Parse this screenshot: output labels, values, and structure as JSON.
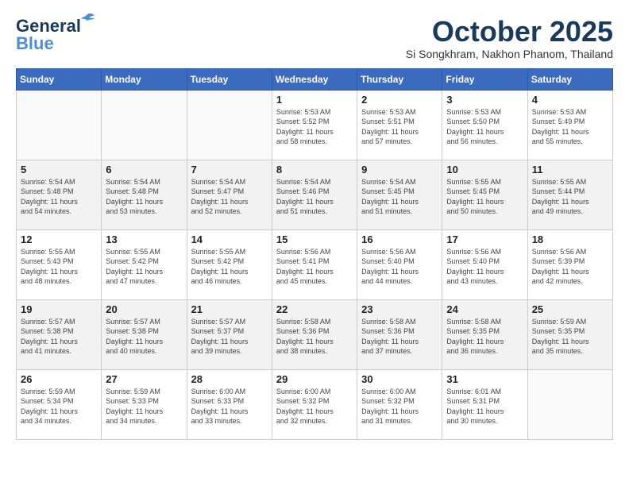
{
  "app": {
    "logo_line1": "General",
    "logo_line2": "Blue"
  },
  "title": "October 2025",
  "subtitle": "Si Songkhram, Nakhon Phanom, Thailand",
  "weekdays": [
    "Sunday",
    "Monday",
    "Tuesday",
    "Wednesday",
    "Thursday",
    "Friday",
    "Saturday"
  ],
  "weeks": [
    [
      {
        "day": "",
        "info": ""
      },
      {
        "day": "",
        "info": ""
      },
      {
        "day": "",
        "info": ""
      },
      {
        "day": "1",
        "info": "Sunrise: 5:53 AM\nSunset: 5:52 PM\nDaylight: 11 hours\nand 58 minutes."
      },
      {
        "day": "2",
        "info": "Sunrise: 5:53 AM\nSunset: 5:51 PM\nDaylight: 11 hours\nand 57 minutes."
      },
      {
        "day": "3",
        "info": "Sunrise: 5:53 AM\nSunset: 5:50 PM\nDaylight: 11 hours\nand 56 minutes."
      },
      {
        "day": "4",
        "info": "Sunrise: 5:53 AM\nSunset: 5:49 PM\nDaylight: 11 hours\nand 55 minutes."
      }
    ],
    [
      {
        "day": "5",
        "info": "Sunrise: 5:54 AM\nSunset: 5:48 PM\nDaylight: 11 hours\nand 54 minutes."
      },
      {
        "day": "6",
        "info": "Sunrise: 5:54 AM\nSunset: 5:48 PM\nDaylight: 11 hours\nand 53 minutes."
      },
      {
        "day": "7",
        "info": "Sunrise: 5:54 AM\nSunset: 5:47 PM\nDaylight: 11 hours\nand 52 minutes."
      },
      {
        "day": "8",
        "info": "Sunrise: 5:54 AM\nSunset: 5:46 PM\nDaylight: 11 hours\nand 51 minutes."
      },
      {
        "day": "9",
        "info": "Sunrise: 5:54 AM\nSunset: 5:45 PM\nDaylight: 11 hours\nand 51 minutes."
      },
      {
        "day": "10",
        "info": "Sunrise: 5:55 AM\nSunset: 5:45 PM\nDaylight: 11 hours\nand 50 minutes."
      },
      {
        "day": "11",
        "info": "Sunrise: 5:55 AM\nSunset: 5:44 PM\nDaylight: 11 hours\nand 49 minutes."
      }
    ],
    [
      {
        "day": "12",
        "info": "Sunrise: 5:55 AM\nSunset: 5:43 PM\nDaylight: 11 hours\nand 48 minutes."
      },
      {
        "day": "13",
        "info": "Sunrise: 5:55 AM\nSunset: 5:42 PM\nDaylight: 11 hours\nand 47 minutes."
      },
      {
        "day": "14",
        "info": "Sunrise: 5:55 AM\nSunset: 5:42 PM\nDaylight: 11 hours\nand 46 minutes."
      },
      {
        "day": "15",
        "info": "Sunrise: 5:56 AM\nSunset: 5:41 PM\nDaylight: 11 hours\nand 45 minutes."
      },
      {
        "day": "16",
        "info": "Sunrise: 5:56 AM\nSunset: 5:40 PM\nDaylight: 11 hours\nand 44 minutes."
      },
      {
        "day": "17",
        "info": "Sunrise: 5:56 AM\nSunset: 5:40 PM\nDaylight: 11 hours\nand 43 minutes."
      },
      {
        "day": "18",
        "info": "Sunrise: 5:56 AM\nSunset: 5:39 PM\nDaylight: 11 hours\nand 42 minutes."
      }
    ],
    [
      {
        "day": "19",
        "info": "Sunrise: 5:57 AM\nSunset: 5:38 PM\nDaylight: 11 hours\nand 41 minutes."
      },
      {
        "day": "20",
        "info": "Sunrise: 5:57 AM\nSunset: 5:38 PM\nDaylight: 11 hours\nand 40 minutes."
      },
      {
        "day": "21",
        "info": "Sunrise: 5:57 AM\nSunset: 5:37 PM\nDaylight: 11 hours\nand 39 minutes."
      },
      {
        "day": "22",
        "info": "Sunrise: 5:58 AM\nSunset: 5:36 PM\nDaylight: 11 hours\nand 38 minutes."
      },
      {
        "day": "23",
        "info": "Sunrise: 5:58 AM\nSunset: 5:36 PM\nDaylight: 11 hours\nand 37 minutes."
      },
      {
        "day": "24",
        "info": "Sunrise: 5:58 AM\nSunset: 5:35 PM\nDaylight: 11 hours\nand 36 minutes."
      },
      {
        "day": "25",
        "info": "Sunrise: 5:59 AM\nSunset: 5:35 PM\nDaylight: 11 hours\nand 35 minutes."
      }
    ],
    [
      {
        "day": "26",
        "info": "Sunrise: 5:59 AM\nSunset: 5:34 PM\nDaylight: 11 hours\nand 34 minutes."
      },
      {
        "day": "27",
        "info": "Sunrise: 5:59 AM\nSunset: 5:33 PM\nDaylight: 11 hours\nand 34 minutes."
      },
      {
        "day": "28",
        "info": "Sunrise: 6:00 AM\nSunset: 5:33 PM\nDaylight: 11 hours\nand 33 minutes."
      },
      {
        "day": "29",
        "info": "Sunrise: 6:00 AM\nSunset: 5:32 PM\nDaylight: 11 hours\nand 32 minutes."
      },
      {
        "day": "30",
        "info": "Sunrise: 6:00 AM\nSunset: 5:32 PM\nDaylight: 11 hours\nand 31 minutes."
      },
      {
        "day": "31",
        "info": "Sunrise: 6:01 AM\nSunset: 5:31 PM\nDaylight: 11 hours\nand 30 minutes."
      },
      {
        "day": "",
        "info": ""
      }
    ]
  ]
}
